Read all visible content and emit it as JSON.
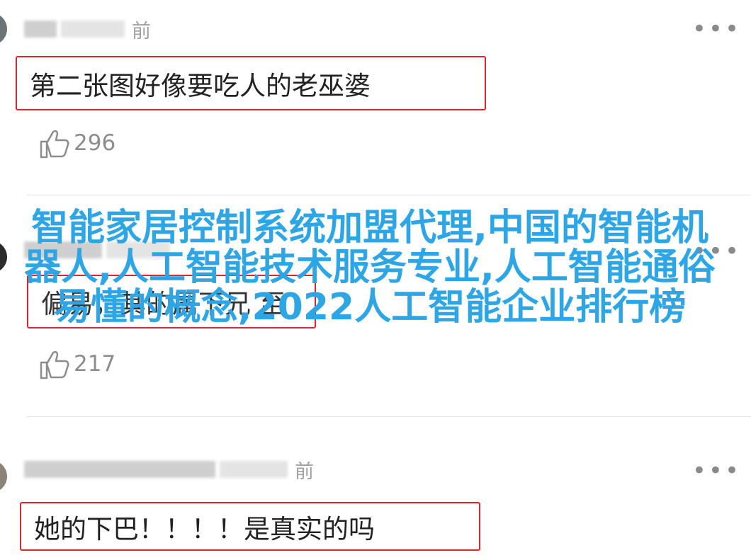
{
  "comments": [
    {
      "time_suffix": "前",
      "text": "第二张图好像要吃人的老巫婆",
      "likes": "296",
      "more": "•••"
    },
    {
      "time_suffix": "",
      "text": "偏易，其的属下兄 至",
      "likes": "217",
      "more": "•••"
    },
    {
      "time_suffix": "前",
      "text": "她的下巴！！！！是真实的吗",
      "more": "•••"
    }
  ],
  "overlay": {
    "text": "智能家居控制系统加盟代理,中国的智能机器人,人工智能技术服务专业,人工智能通俗易懂的概念,2022人工智能企业排行榜",
    "color": "#2ea6e6"
  },
  "colors": {
    "highlight_border": "#e0262c",
    "muted": "#8d8d8d"
  }
}
